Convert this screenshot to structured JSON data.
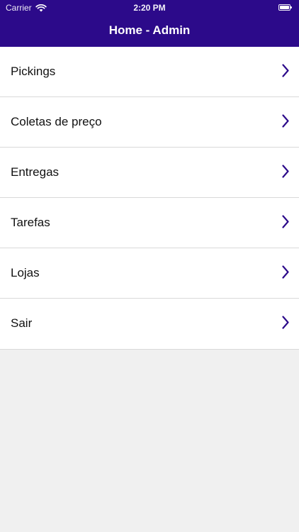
{
  "status_bar": {
    "carrier": "Carrier",
    "time": "2:20 PM",
    "wifi_icon": "wifi-icon",
    "battery_icon": "battery-icon",
    "battery_level": 1.0
  },
  "nav": {
    "title": "Home - Admin",
    "color": "#2c0a8a"
  },
  "menu": {
    "chevron_icon": "chevron-right-icon",
    "chevron_color": "#2c0a8a",
    "items": [
      {
        "label": "Pickings"
      },
      {
        "label": "Coletas de preço"
      },
      {
        "label": "Entregas"
      },
      {
        "label": "Tarefas"
      },
      {
        "label": "Lojas"
      },
      {
        "label": "Sair"
      }
    ]
  }
}
